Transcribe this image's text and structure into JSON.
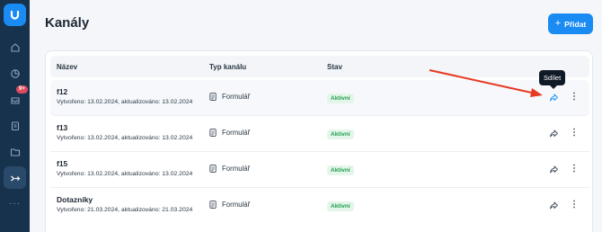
{
  "sidebar": {
    "badge": "9+",
    "more": "···"
  },
  "header": {
    "title": "Kanály",
    "add_label": "Přidat",
    "add_icon": "plus-icon"
  },
  "table": {
    "columns": [
      "Název",
      "Typ kanálu",
      "Stav"
    ],
    "rows": [
      {
        "name": "f12",
        "meta": "Vytvořeno: 13.02.2024, aktualizováno: 13.02.2024",
        "type": "Formulář",
        "status": "Aktivní"
      },
      {
        "name": "f13",
        "meta": "Vytvořeno: 13.02.2024, aktualizováno: 13.02.2024",
        "type": "Formulář",
        "status": "Aktivní"
      },
      {
        "name": "f15",
        "meta": "Vytvořeno: 13.02.2024, aktualizováno: 13.02.2024",
        "type": "Formulář",
        "status": "Aktivní"
      },
      {
        "name": "Dotazníky",
        "meta": "Vytvořeno: 21.03.2024, aktualizováno: 21.03.2024",
        "type": "Formulář",
        "status": "Aktivní"
      }
    ]
  },
  "tooltip": {
    "text": "Sdílet"
  },
  "colors": {
    "primary": "#1a8bf2",
    "sidebar": "#17324d",
    "status_active_text": "#1f9d4e",
    "status_active_bg": "#e4f6e9",
    "annotation_arrow": "#e53922"
  }
}
